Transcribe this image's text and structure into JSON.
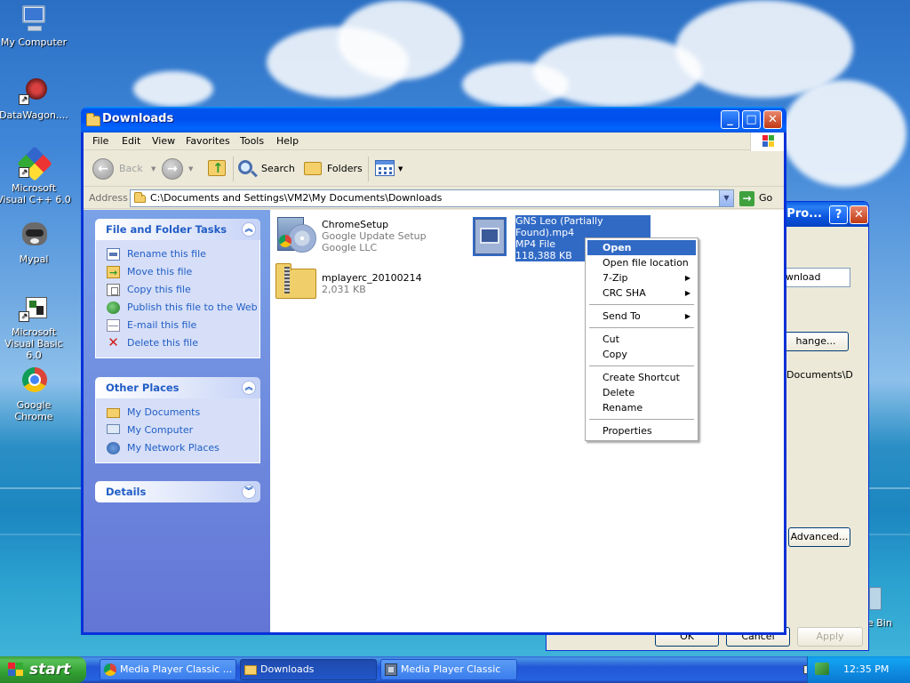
{
  "desktop": {
    "icons": [
      {
        "label": "My Computer",
        "icon": "my-computer-icon"
      },
      {
        "label": "DataWagon....",
        "icon": "datawagon-icon"
      },
      {
        "label": "Microsoft Visual C++ 6.0",
        "icon": "visual-cpp-icon"
      },
      {
        "label": "Mypal",
        "icon": "mypal-icon"
      },
      {
        "label": "Microsoft Visual Basic 6.0",
        "icon": "visual-basic-icon"
      },
      {
        "label": "Google Chrome",
        "icon": "chrome-icon"
      }
    ],
    "recycle_bin_fragment": "e Bin"
  },
  "background_dialog": {
    "title_fragment": "l Pro...",
    "field_fragment": "wnload",
    "change_button": "hange...",
    "path_fragment": "Documents\\D",
    "advanced_button": "Advanced...",
    "ok_button": "OK",
    "cancel_button": "Cancel",
    "apply_button": "Apply"
  },
  "window": {
    "title": "Downloads",
    "menu": [
      "File",
      "Edit",
      "View",
      "Favorites",
      "Tools",
      "Help"
    ],
    "toolbar": {
      "back": "Back",
      "search": "Search",
      "folders": "Folders"
    },
    "address": {
      "label": "Address",
      "path": "C:\\Documents and Settings\\VM2\\My Documents\\Downloads",
      "go": "Go"
    }
  },
  "taskpane": {
    "file_tasks": {
      "title": "File and Folder Tasks",
      "items": [
        {
          "label": "Rename this file",
          "icon": "rename-icon"
        },
        {
          "label": "Move this file",
          "icon": "move-icon"
        },
        {
          "label": "Copy this file",
          "icon": "copy-icon"
        },
        {
          "label": "Publish this file to the Web",
          "icon": "publish-web-icon"
        },
        {
          "label": "E-mail this file",
          "icon": "email-icon"
        },
        {
          "label": "Delete this file",
          "icon": "delete-icon"
        }
      ]
    },
    "other_places": {
      "title": "Other Places",
      "items": [
        {
          "label": "My Documents",
          "icon": "my-documents-icon"
        },
        {
          "label": "My Computer",
          "icon": "my-computer-icon"
        },
        {
          "label": "My Network Places",
          "icon": "network-places-icon"
        }
      ]
    },
    "details": {
      "title": "Details"
    }
  },
  "files": [
    {
      "name": "ChromeSetup",
      "line2": "Google Update Setup",
      "line3": "Google LLC",
      "icon": "installer-icon"
    },
    {
      "name": "GNS Leo (Partially Found).mp4",
      "line2": "MP4 File",
      "line3": "118,388 KB",
      "icon": "video-file-icon",
      "selected": true
    },
    {
      "name": "mplayerc_20100214",
      "line2": "2,031 KB",
      "line3": "",
      "icon": "zip-folder-icon"
    }
  ],
  "context_menu": {
    "items": [
      "Open",
      "Open file location",
      "7-Zip",
      "CRC SHA",
      "Send To",
      "Cut",
      "Copy",
      "Create Shortcut",
      "Delete",
      "Rename",
      "Properties"
    ],
    "highlighted": "Open"
  },
  "taskbar": {
    "start": "start",
    "tasks": [
      {
        "label": "Media Player Classic ...",
        "icon": "chrome-icon",
        "active": false
      },
      {
        "label": "Downloads",
        "icon": "folder-icon",
        "active": true
      },
      {
        "label": "Media Player Classic",
        "icon": "mpc-icon",
        "active": false
      }
    ],
    "clock": "12:35 PM"
  },
  "colors": {
    "selection": "#316ac5",
    "titlebar": "#0053ee",
    "task_link": "#215dc6",
    "start_green": "#31a031"
  }
}
